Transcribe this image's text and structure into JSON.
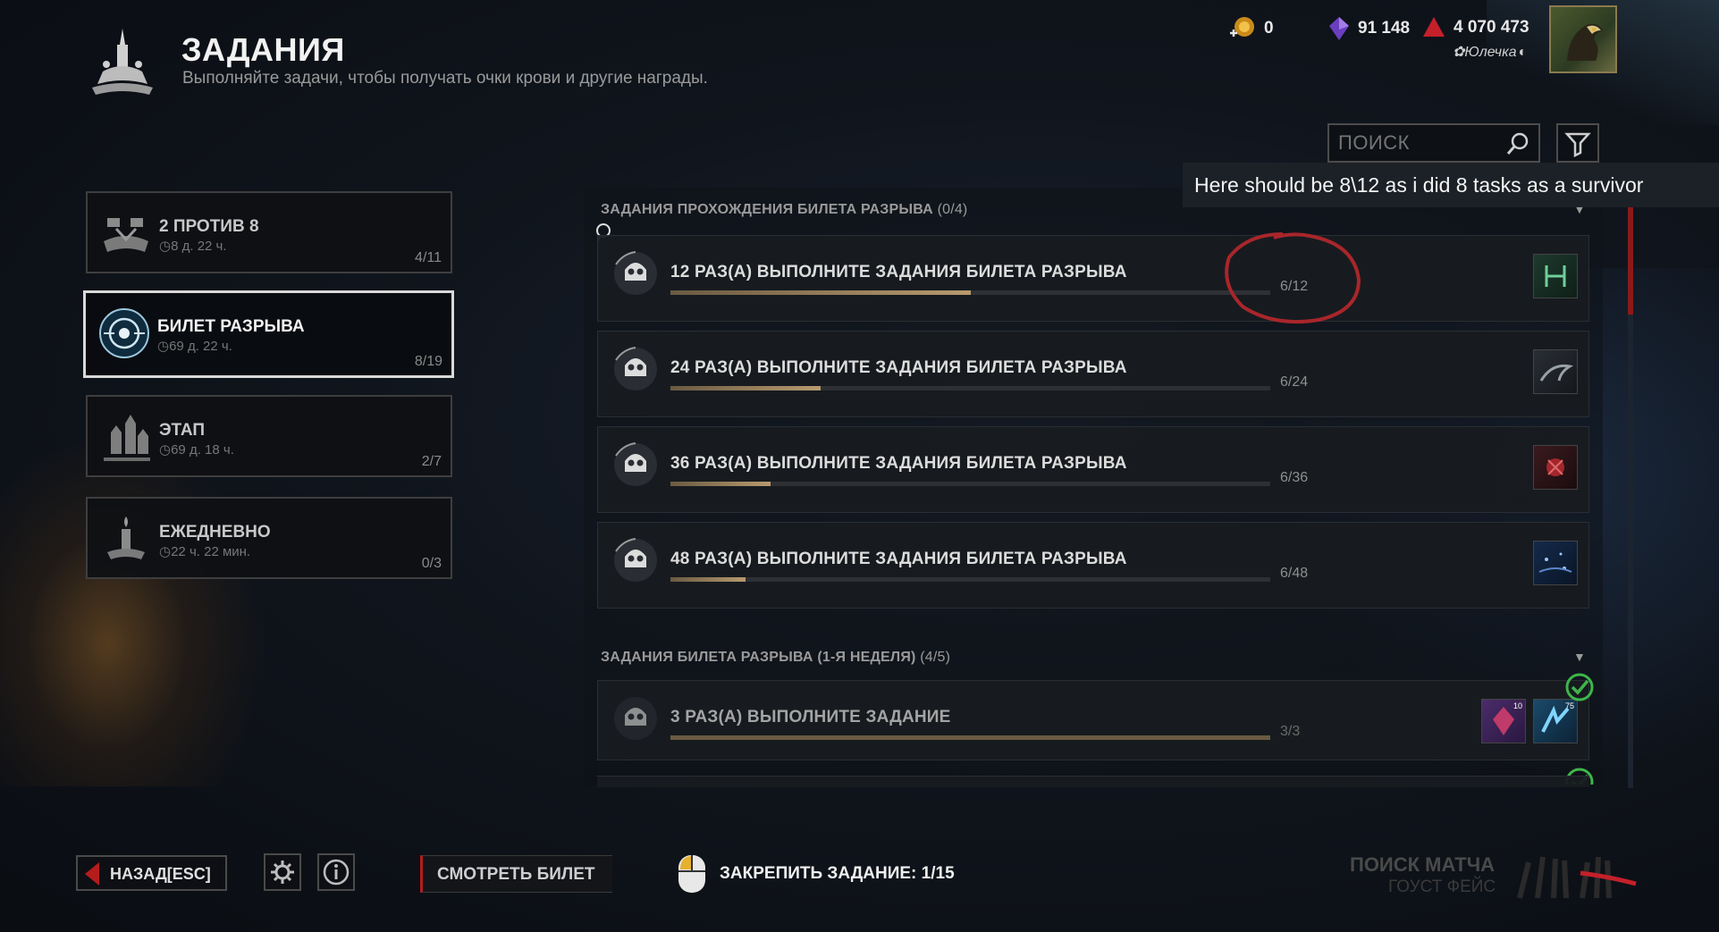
{
  "header": {
    "title": "ЗАДАНИЯ",
    "subtitle": "Выполняйте задачи, чтобы получать очки крови и другие награды."
  },
  "currencies": {
    "auric_cells": "0",
    "iridescent_shards": "91 148",
    "bloodpoints": "4 070 473",
    "player_name": "Юлечка"
  },
  "search": {
    "placeholder": "ПОИСК"
  },
  "annotation": {
    "text": "Here should be 8\\12 as i did 8 tasks as a survivor"
  },
  "categories": [
    {
      "name": "2 ПРОТИВ 8",
      "time": "8 д. 22 ч.",
      "count": "4/11",
      "icon": "2v8-emblem-icon"
    },
    {
      "name": "БИЛЕТ РАЗРЫВА",
      "time": "69 д. 22 ч.",
      "count": "8/19",
      "icon": "rift-pass-icon",
      "active": true
    },
    {
      "name": "ЭТАП",
      "time": "69 д. 18 ч.",
      "count": "2/7",
      "icon": "castle-icon"
    },
    {
      "name": "ЕЖЕДНЕВНО",
      "time": "22 ч. 22 мин.",
      "count": "0/3",
      "icon": "candle-icon"
    }
  ],
  "sections": [
    {
      "title": "ЗАДАНИЯ ПРОХОЖДЕНИЯ БИЛЕТА РАЗРЫВА",
      "count": "(0/4)",
      "tasks": [
        {
          "name": "12 РАЗ(А) ВЫПОЛНИТЕ ЗАДАНИЯ БИЛЕТА РАЗРЫВА",
          "progress": "6/12",
          "fraction": 0.5
        },
        {
          "name": "24 РАЗ(А) ВЫПОЛНИТЕ ЗАДАНИЯ БИЛЕТА РАЗРЫВА",
          "progress": "6/24",
          "fraction": 0.25
        },
        {
          "name": "36 РАЗ(А) ВЫПОЛНИТЕ ЗАДАНИЯ БИЛЕТА РАЗРЫВА",
          "progress": "6/36",
          "fraction": 0.1667
        },
        {
          "name": "48 РАЗ(А) ВЫПОЛНИТЕ ЗАДАНИЯ БИЛЕТА РАЗРЫВА",
          "progress": "6/48",
          "fraction": 0.125
        }
      ]
    },
    {
      "title": "ЗАДАНИЯ БИЛЕТА РАЗРЫВА (1-Я НЕДЕЛЯ)",
      "count": "(4/5)",
      "tasks": [
        {
          "name": "3 РАЗ(А) ВЫПОЛНИТЕ ЗАДАНИЕ",
          "progress": "3/3",
          "fraction": 1.0,
          "completed": true,
          "reward_badges": [
            "10",
            "75"
          ]
        }
      ]
    }
  ],
  "bottom": {
    "back": "НАЗАД",
    "back_key": "[ESC]",
    "view_pass": "СМОТРЕТЬ БИЛЕТ",
    "pin_task": "ЗАКРЕПИТЬ ЗАДАНИЕ: 1/15",
    "match_search": "ПОИСК МАТЧА",
    "match_sub": "ГОУСТ ФЕЙС"
  },
  "colors": {
    "accent_red": "#b51c1c",
    "progress_fill": "#b89a6e",
    "complete_green": "#3fb54a",
    "annotation_circle": "#a8262b"
  }
}
